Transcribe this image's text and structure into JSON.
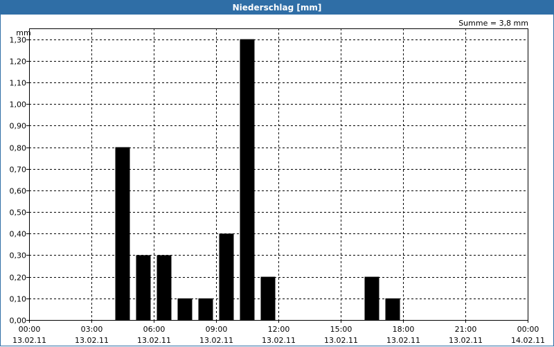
{
  "window": {
    "title": "Niederschlag [mm]"
  },
  "chart_data": {
    "type": "bar",
    "title": "Niederschlag [mm]",
    "unit_label": "mm",
    "sum_label": "Summe = 3,8 mm",
    "ylim": [
      0,
      1.35
    ],
    "y_ticks": [
      "0,00",
      "0,10",
      "0,20",
      "0,30",
      "0,40",
      "0,50",
      "0,60",
      "0,70",
      "0,80",
      "0,90",
      "1,00",
      "1,10",
      "1,20",
      "1,30"
    ],
    "x_ticks": [
      {
        "time": "00:00",
        "date": "13.02.11"
      },
      {
        "time": "03:00",
        "date": "13.02.11"
      },
      {
        "time": "06:00",
        "date": "13.02.11"
      },
      {
        "time": "09:00",
        "date": "13.02.11"
      },
      {
        "time": "12:00",
        "date": "13.02.11"
      },
      {
        "time": "15:00",
        "date": "13.02.11"
      },
      {
        "time": "18:00",
        "date": "13.02.11"
      },
      {
        "time": "21:00",
        "date": "13.02.11"
      },
      {
        "time": "00:00",
        "date": "14.02.11"
      }
    ],
    "xlim": [
      "13.02.11 00:00",
      "14.02.11 00:00"
    ],
    "grid": true,
    "series": [
      {
        "color": "#000000",
        "bars": [
          {
            "start": "13.02.11 04:00",
            "value": 0.8
          },
          {
            "start": "13.02.11 05:00",
            "value": 0.3
          },
          {
            "start": "13.02.11 06:00",
            "value": 0.3
          },
          {
            "start": "13.02.11 07:00",
            "value": 0.1
          },
          {
            "start": "13.02.11 08:00",
            "value": 0.1
          },
          {
            "start": "13.02.11 09:00",
            "value": 0.4
          },
          {
            "start": "13.02.11 10:00",
            "value": 1.3
          },
          {
            "start": "13.02.11 11:00",
            "value": 0.2
          },
          {
            "start": "13.02.11 16:00",
            "value": 0.2
          },
          {
            "start": "13.02.11 17:00",
            "value": 0.1
          }
        ]
      }
    ]
  }
}
